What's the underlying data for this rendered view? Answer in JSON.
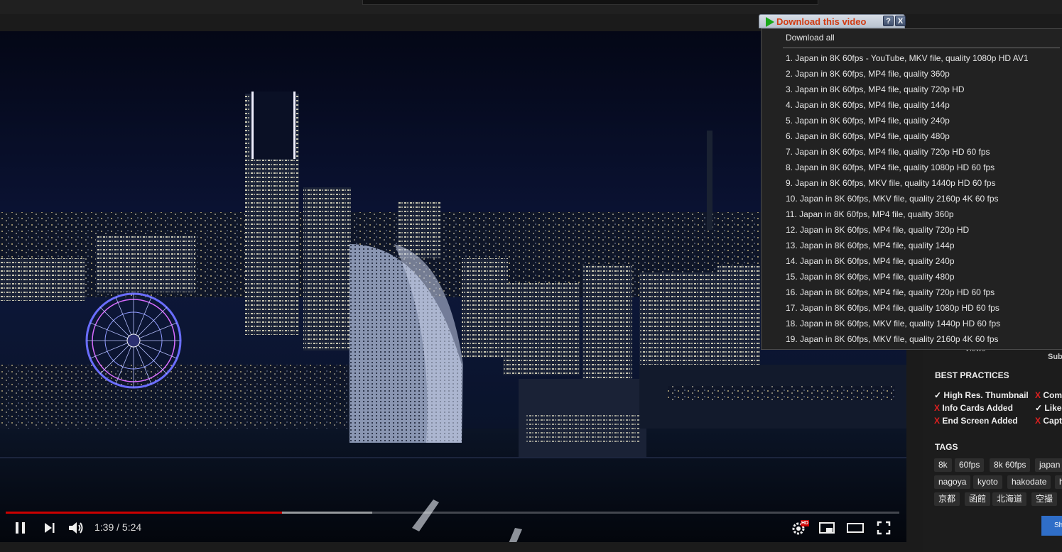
{
  "player": {
    "time": "1:39 / 5:24",
    "progress_played": 0.309,
    "progress_buffered": 0.41,
    "hd_badge": "HD"
  },
  "download": {
    "button_label": "Download this video",
    "help_label": "?",
    "close_label": "X",
    "download_all": "Download all",
    "items": [
      "1.  Japan in 8K 60fps - YouTube,  MKV file, quality 1080p HD AV1",
      "2.  Japan in 8K 60fps,  MP4 file, quality 360p",
      "3.  Japan in 8K 60fps,  MP4 file, quality 720p HD",
      "4.  Japan in 8K 60fps,  MP4 file, quality 144p",
      "5.  Japan in 8K 60fps,  MP4 file, quality 240p",
      "6.  Japan in 8K 60fps,  MP4 file, quality 480p",
      "7.  Japan in 8K 60fps,  MP4 file, quality 720p HD 60 fps",
      "8.  Japan in 8K 60fps,  MP4 file, quality 1080p HD 60 fps",
      "9.  Japan in 8K 60fps,  MKV file, quality 1440p HD 60 fps",
      "10.  Japan in 8K 60fps,  MKV file, quality 2160p 4K 60 fps",
      "11.  Japan in 8K 60fps,  MP4 file, quality 360p",
      "12.  Japan in 8K 60fps,  MP4 file, quality 720p HD",
      "13.  Japan in 8K 60fps,  MP4 file, quality 144p",
      "14.  Japan in 8K 60fps,  MP4 file, quality 240p",
      "15.  Japan in 8K 60fps,  MP4 file, quality 480p",
      "16.  Japan in 8K 60fps,  MP4 file, quality 720p HD 60 fps",
      "17.  Japan in 8K 60fps,  MP4 file, quality 1080p HD 60 fps",
      "18.  Japan in 8K 60fps,  MKV file, quality 1440p HD 60 fps",
      "19.  Japan in 8K 60fps,  MKV file, quality 2160p 4K 60 fps"
    ]
  },
  "sidebar": {
    "views_label": "Views",
    "subs_label": "Sub",
    "best_practices_title": "BEST PRACTICES",
    "best_practices": [
      {
        "mark": "✓",
        "label": "High Res. Thumbnail",
        "status": "ok"
      },
      {
        "mark": "X",
        "label": "Com",
        "status": "fail"
      },
      {
        "mark": "X",
        "label": "Info Cards Added",
        "status": "fail"
      },
      {
        "mark": "✓",
        "label": "Liked",
        "status": "ok"
      },
      {
        "mark": "X",
        "label": "End Screen Added",
        "status": "fail"
      },
      {
        "mark": "X",
        "label": "Capti",
        "status": "fail"
      }
    ],
    "tags_title": "TAGS",
    "tags": [
      "8k",
      "60fps",
      "8k 60fps",
      "japan",
      "nagoya",
      "kyoto",
      "hakodate",
      "h",
      "京都",
      "函館",
      "北海道",
      "空撮"
    ],
    "button_label": "Sh"
  },
  "colors": {
    "progress_red": "#cc0000",
    "download_label": "#d23b12",
    "fail_red": "#e02020",
    "button_blue": "#2f6ec8"
  }
}
